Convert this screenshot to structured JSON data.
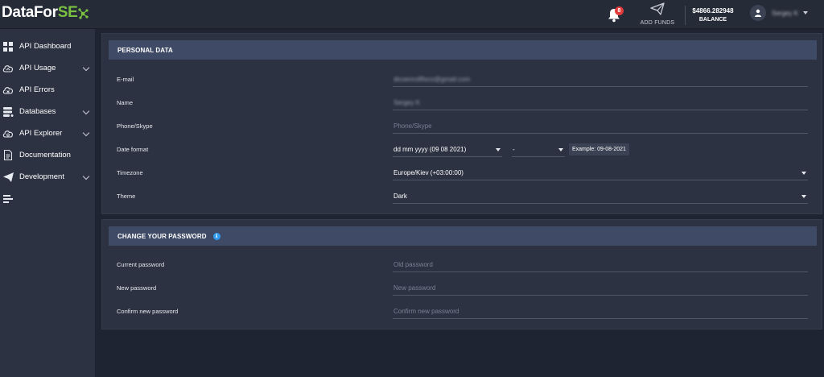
{
  "brand": {
    "logo_main": "DataFor",
    "logo_accent": "SE"
  },
  "header": {
    "notifications_count": "8",
    "add_funds_label": "ADD FUNDS",
    "balance_amount": "$4866.282948",
    "balance_label": "BALANCE",
    "user_name": "Sergey K"
  },
  "sidebar": {
    "items": [
      {
        "label": "API Dashboard",
        "icon": "dashboard-icon",
        "has_chevron": false
      },
      {
        "label": "API Usage",
        "icon": "cloud-icon",
        "has_chevron": true
      },
      {
        "label": "API Errors",
        "icon": "cloud-error-icon",
        "has_chevron": false
      },
      {
        "label": "Databases",
        "icon": "database-icon",
        "has_chevron": true
      },
      {
        "label": "API Explorer",
        "icon": "cloud-explorer-icon",
        "has_chevron": true
      },
      {
        "label": "Documentation",
        "icon": "document-icon",
        "has_chevron": false
      },
      {
        "label": "Development",
        "icon": "paper-plane-icon",
        "has_chevron": true
      },
      {
        "label": "",
        "icon": "list-icon",
        "has_chevron": false
      }
    ]
  },
  "personal": {
    "title": "PERSONAL DATA",
    "email_label": "E-mail",
    "email_value": "dicoenrollfisco@gmail.com",
    "name_label": "Name",
    "name_value": "Sergey K",
    "phone_label": "Phone/Skype",
    "phone_placeholder": "Phone/Skype",
    "date_label": "Date format",
    "date_value": "dd mm yyyy (09 08 2021)",
    "separator_value": "-",
    "date_example": "Example: 09-08-2021",
    "timezone_label": "Timezone",
    "timezone_value": "Europe/Kiev (+03:00:00)",
    "theme_label": "Theme",
    "theme_value": "Dark"
  },
  "password": {
    "title": "CHANGE YOUR PASSWORD",
    "current_label": "Current password",
    "current_placeholder": "Old password",
    "new_label": "New password",
    "new_placeholder": "New password",
    "confirm_label": "Confirm new password",
    "confirm_placeholder": "Confirm new password"
  },
  "colors": {
    "background": "#1f2432",
    "panel": "#2c3241",
    "panel_header": "#3e4a66",
    "accent_green": "#7ac142",
    "badge_red": "#e23b3b",
    "info_blue": "#2f9cf0"
  }
}
